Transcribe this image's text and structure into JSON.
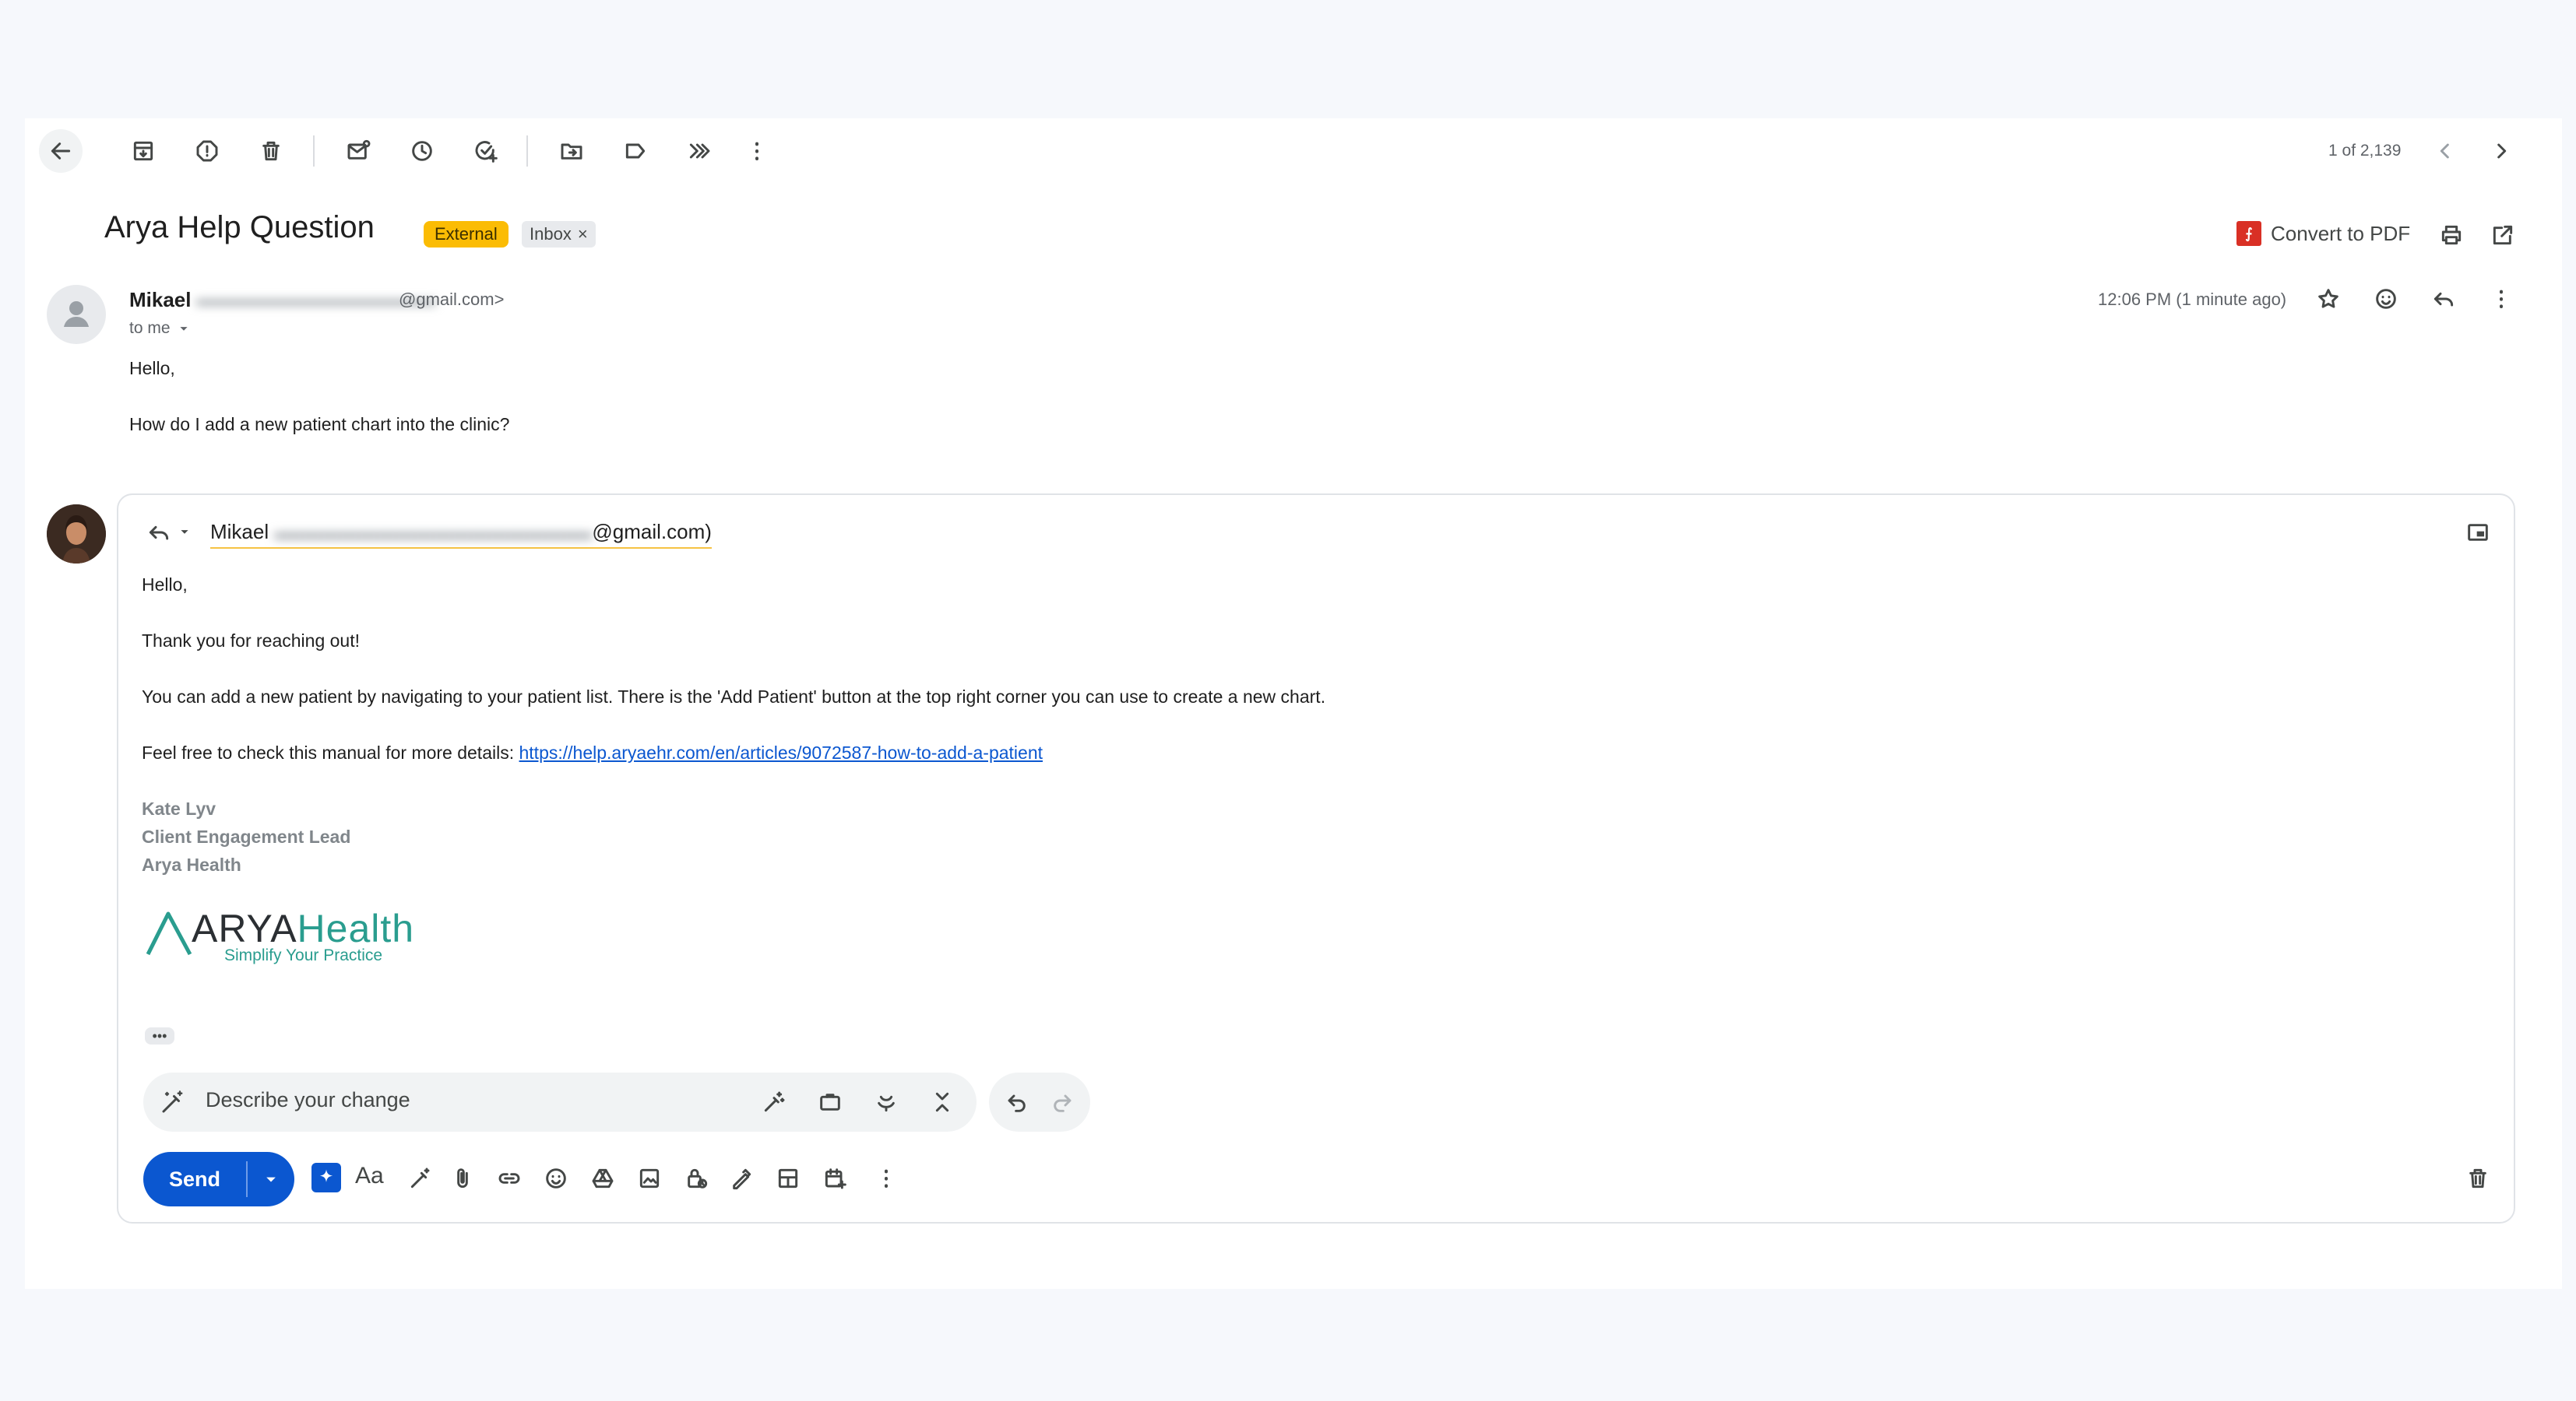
{
  "toolbar": {
    "pagination": "1 of 2,139",
    "icons": [
      "back-arrow-icon",
      "archive-icon",
      "report-spam-icon",
      "delete-icon",
      "mark-unread-icon",
      "snooze-icon",
      "add-task-icon",
      "move-to-icon",
      "label-icon",
      "forward-all-icon",
      "more-vert-icon"
    ]
  },
  "email": {
    "subject": "Arya Help Question",
    "badge_external": "External",
    "badge_inbox": "Inbox",
    "badge_inbox_close": "×",
    "convert_pdf": "Convert to PDF",
    "sender_name": "Mikael",
    "sender_email": "@gmail.com>",
    "to_label": "to me",
    "timestamp": "12:06 PM (1 minute ago)",
    "body": [
      "Hello,",
      "How do I add a new patient chart into the clinic?"
    ]
  },
  "reply": {
    "recipient_name": "Mikael",
    "recipient_email": "@gmail.com)",
    "greeting": "Hello,",
    "line1": "Thank you for reaching out!",
    "line2": "You can add a new patient by navigating to your patient list. There is the 'Add Patient' button at the top right corner you can use to create a new chart.",
    "line3_prefix": "Feel free to check this manual for more details: ",
    "line3_link": "https://help.aryaehr.com/en/articles/9072587-how-to-add-a-patient",
    "signature": [
      "Kate Lyv",
      "Client Engagement Lead",
      "Arya Health"
    ],
    "logo_arya": "ARYA",
    "logo_health": "Health",
    "logo_tagline": "Simplify Your Practice",
    "more_dots": "•••",
    "ai_placeholder": "Describe your change",
    "send_label": "Send",
    "format_label": "Aa"
  },
  "colors": {
    "accent": "#0b57d0",
    "external_badge": "#fbbc04",
    "brand_teal": "#2a9d8f"
  }
}
